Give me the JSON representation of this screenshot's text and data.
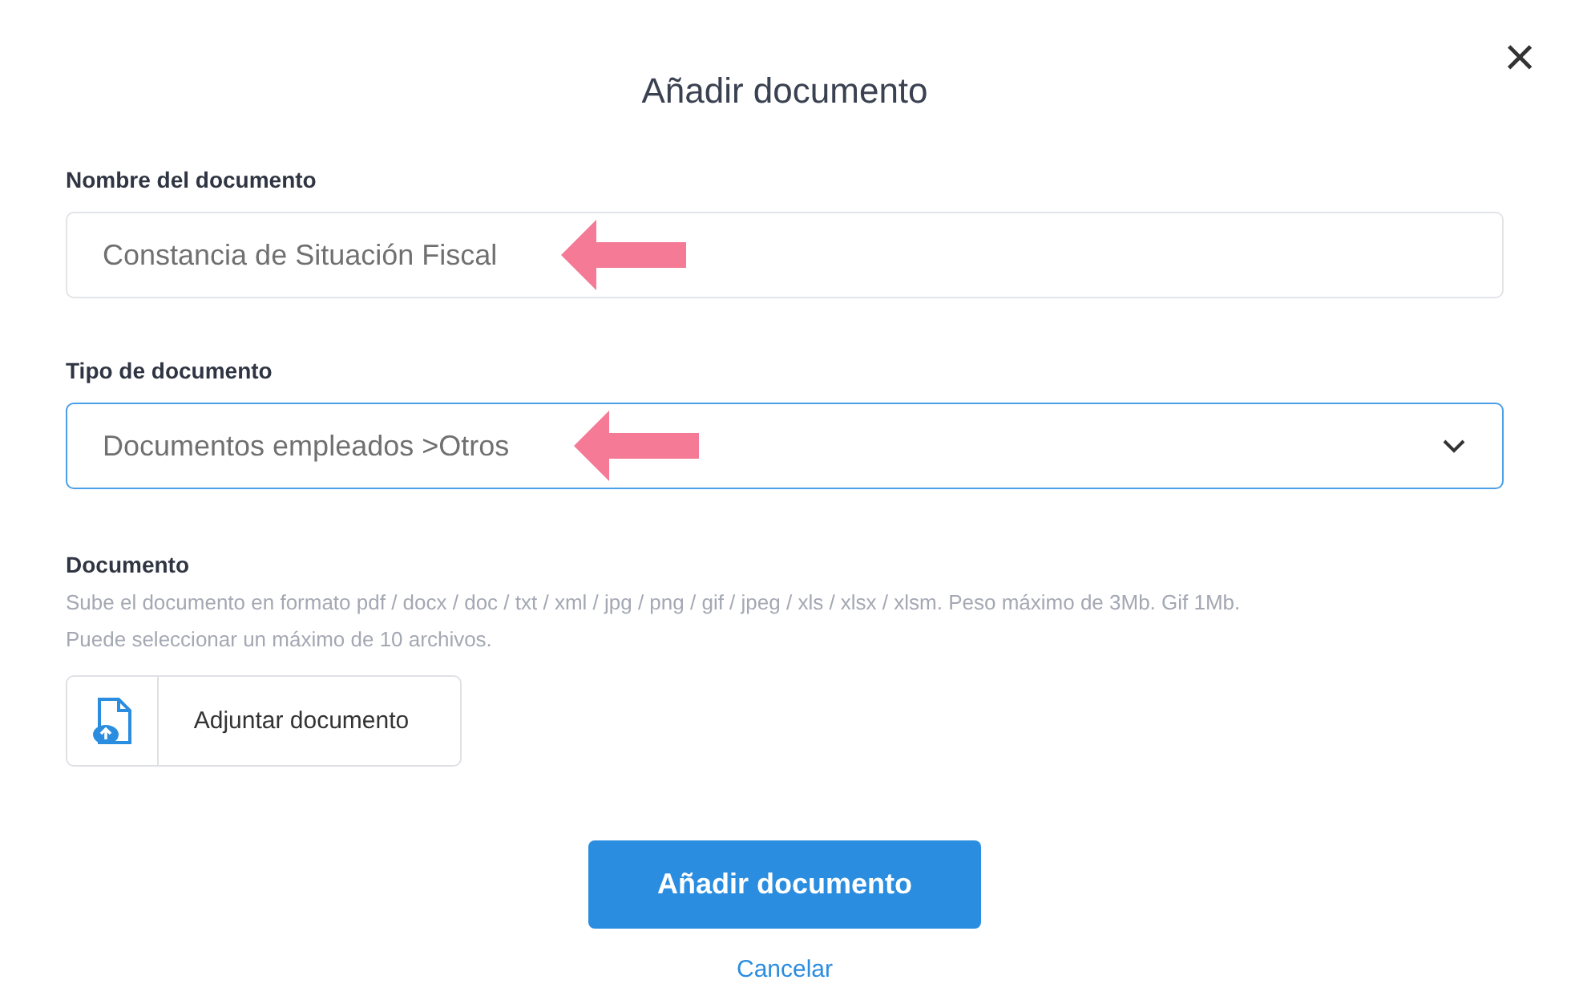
{
  "dialog": {
    "title": "Añadir documento",
    "close_label": "×"
  },
  "fields": [
    {
      "kind": "text",
      "label": "Nombre del documento",
      "value": "Constancia de Situación Fiscal",
      "focused": false,
      "annotated": true
    },
    {
      "kind": "select",
      "label": "Tipo de documento",
      "value": "Documentos empleados >Otros",
      "focused": true,
      "annotated": true
    }
  ],
  "document": {
    "label": "Documento",
    "hint": "Sube el documento en formato pdf / docx / doc / txt / xml / jpg / png / gif / jpeg / xls / xlsx / xlsm. Peso máximo de 3Mb. Gif 1Mb.",
    "hint_2": "Puede seleccionar un máximo de 10 archivos.",
    "attach_button": "Adjuntar documento"
  },
  "submit_button": "Añadir documento",
  "cancel_link": "Cancelar"
}
